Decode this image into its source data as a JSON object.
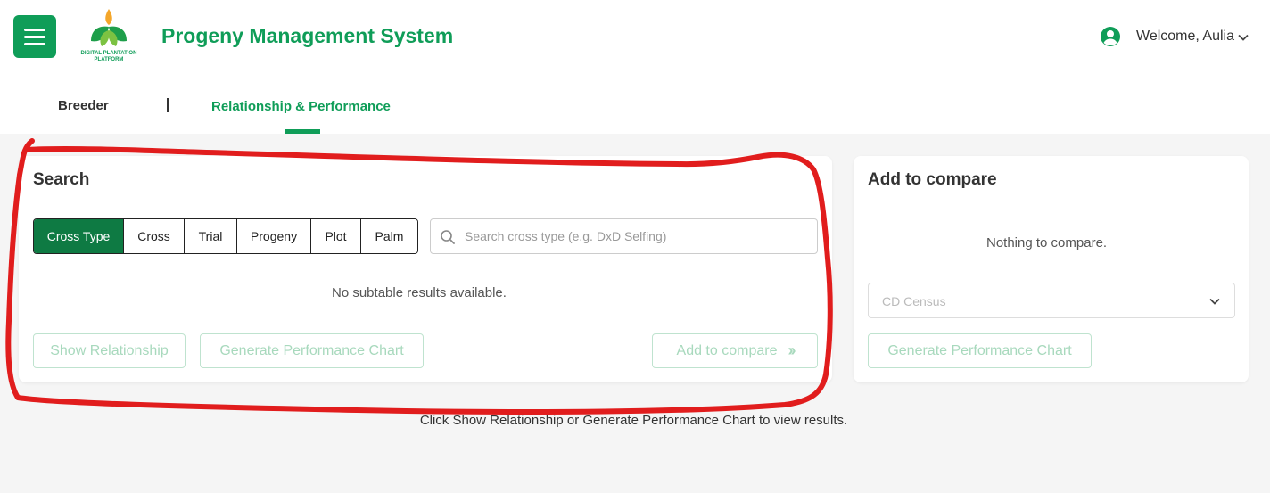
{
  "header": {
    "menu_icon": "hamburger-menu-icon",
    "logo_text": "DIGITAL PLANTATION PLATFORM",
    "app_title": "Progeny Management System",
    "user_icon": "account-circle-icon",
    "welcome": "Welcome, Aulia"
  },
  "tabs": [
    {
      "label": "Breeder",
      "active": false
    },
    {
      "label": "Relationship & Performance",
      "active": true
    }
  ],
  "search_panel": {
    "title": "Search",
    "filters": [
      {
        "label": "Cross Type",
        "active": true
      },
      {
        "label": "Cross",
        "active": false
      },
      {
        "label": "Trial",
        "active": false
      },
      {
        "label": "Progeny",
        "active": false
      },
      {
        "label": "Plot",
        "active": false
      },
      {
        "label": "Palm",
        "active": false
      }
    ],
    "search_placeholder": "Search cross type (e.g. DxD Selfing)",
    "search_value": "",
    "empty_message": "No subtable results available.",
    "buttons": {
      "show_relationship": "Show Relationship",
      "generate_chart": "Generate Performance Chart",
      "add_to_compare": "Add to compare"
    }
  },
  "compare_panel": {
    "title": "Add to compare",
    "empty_message": "Nothing to compare.",
    "select_value": "CD Census",
    "generate_chart": "Generate Performance Chart"
  },
  "results_hint": "Click Show Relationship or Generate Performance Chart to view results.",
  "colors": {
    "brand_green": "#0f9d58",
    "active_filter": "#0e7a43",
    "disabled_button_text": "#a8d9bd",
    "annotation_red": "#e11d1d"
  }
}
